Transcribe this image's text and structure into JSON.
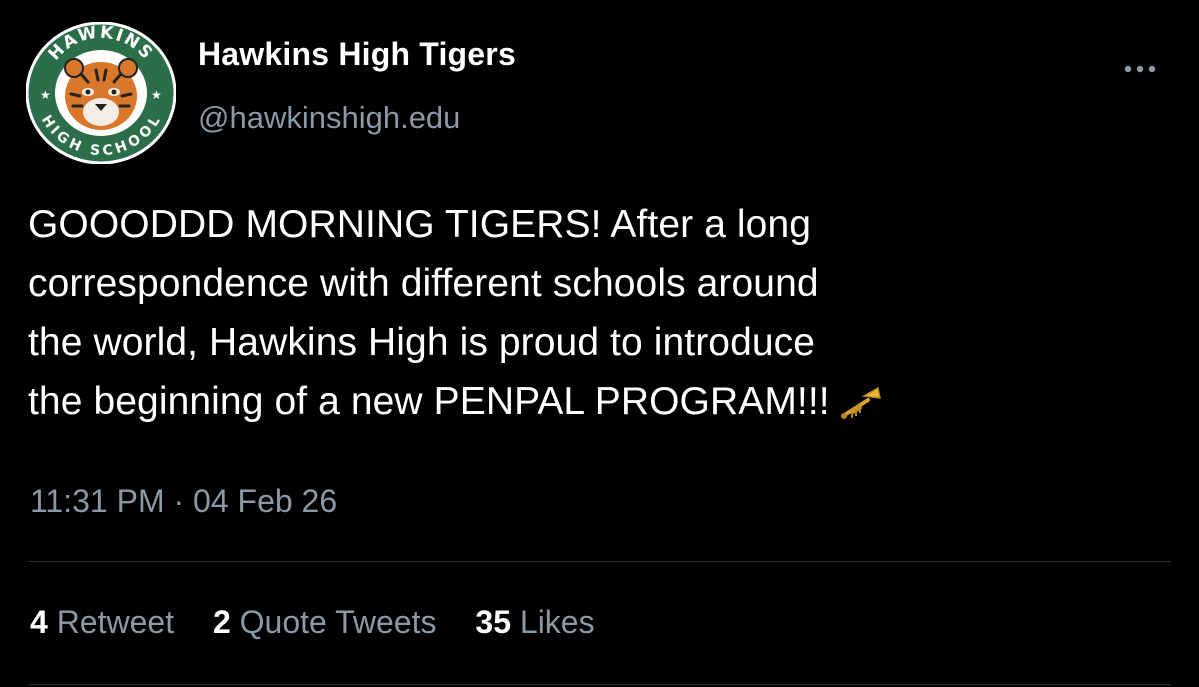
{
  "author": {
    "name": "Hawkins High Tigers",
    "handle": "@hawkinshigh.edu",
    "avatar": {
      "icon": "school-crest-tiger-icon",
      "text_top": "HAWKINS",
      "text_bottom": "HIGH SCHOOL",
      "ring_color": "#2c6e4a",
      "text_color": "#ffffff"
    }
  },
  "more_icon": "ellipsis-icon",
  "tweet": {
    "lines": [
      "GOOODDD MORNING TIGERS! After a long",
      "correspondence with different schools around",
      "the world, Hawkins High is proud to introduce",
      "the beginning of a new PENPAL PROGRAM!!!"
    ],
    "emoji": "trumpet-icon"
  },
  "meta": {
    "time": "11:31 PM",
    "separator": "·",
    "date": "04 Feb 26"
  },
  "stats": {
    "retweets": {
      "count": "4",
      "label": "Retweet"
    },
    "quotes": {
      "count": "2",
      "label": "Quote Tweets"
    },
    "likes": {
      "count": "35",
      "label": "Likes"
    }
  },
  "colors": {
    "background": "#000000",
    "text": "#ffffff",
    "secondary": "#8b98a5",
    "divider": "#2f3336",
    "crest_green": "#2c6e4a"
  }
}
